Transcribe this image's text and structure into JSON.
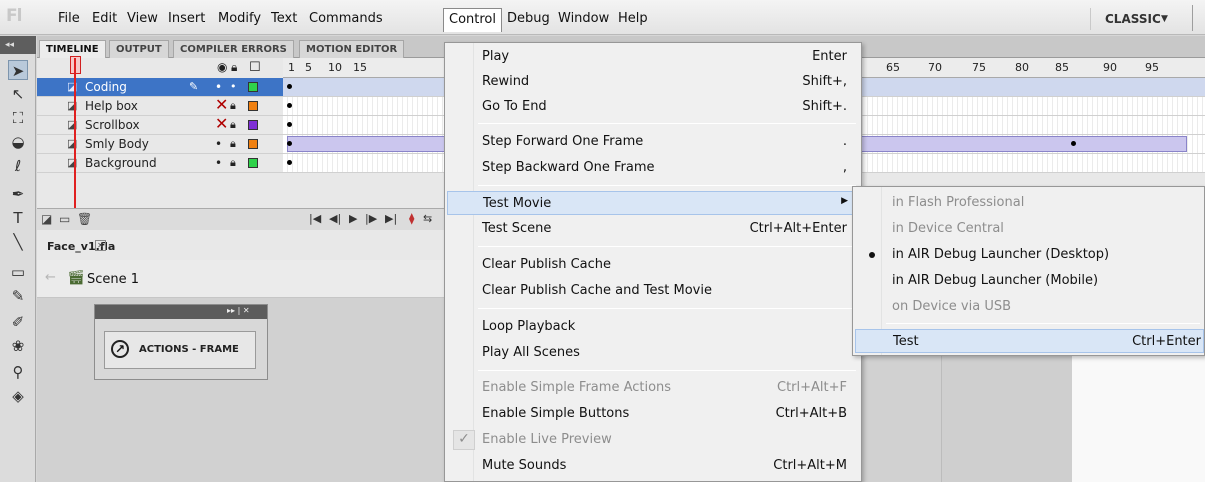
{
  "app": {
    "logo": "Fl"
  },
  "menubar": {
    "items": [
      "File",
      "Edit",
      "View",
      "Insert",
      "Modify",
      "Text",
      "Commands",
      "Control",
      "Debug",
      "Window",
      "Help"
    ],
    "active": "Control",
    "workspace": "CLASSIC"
  },
  "panel_tabs": [
    "TIMELINE",
    "OUTPUT",
    "COMPILER ERRORS",
    "MOTION EDITOR"
  ],
  "timeline": {
    "ruler": [
      "1",
      "5",
      "10",
      "15",
      "65",
      "70",
      "75",
      "80",
      "85",
      "90",
      "95"
    ],
    "current_frame": "1",
    "layers": [
      {
        "name": "Coding",
        "selected": true,
        "color": "#2fd24a"
      },
      {
        "name": "Help box",
        "hidden": true,
        "color": "#f08010"
      },
      {
        "name": "Scrollbox",
        "hidden": true,
        "color": "#7f2fd6"
      },
      {
        "name": "Smly Body",
        "color": "#f08010"
      },
      {
        "name": "Background",
        "color": "#2fd24a"
      }
    ]
  },
  "document": {
    "tab": "Face_v1.fla"
  },
  "scene": {
    "label": "Scene 1"
  },
  "actions_panel": {
    "label": "ACTIONS - FRAME"
  },
  "control_menu": {
    "items": [
      {
        "label": "Play",
        "shortcut": "Enter"
      },
      {
        "label": "Rewind",
        "shortcut": "Shift+,"
      },
      {
        "label": "Go To End",
        "shortcut": "Shift+."
      },
      {
        "label": "Step Forward One Frame",
        "shortcut": "."
      },
      {
        "label": "Step Backward One Frame",
        "shortcut": ","
      },
      {
        "label": "Test Movie",
        "shortcut": "",
        "submenu": true
      },
      {
        "label": "Test Scene",
        "shortcut": "Ctrl+Alt+Enter"
      },
      {
        "label": "Clear Publish Cache",
        "shortcut": ""
      },
      {
        "label": "Clear Publish Cache and Test Movie",
        "shortcut": ""
      },
      {
        "label": "Loop Playback",
        "shortcut": ""
      },
      {
        "label": "Play All Scenes",
        "shortcut": ""
      },
      {
        "label": "Enable Simple Frame Actions",
        "shortcut": "Ctrl+Alt+F",
        "disabled": true
      },
      {
        "label": "Enable Simple Buttons",
        "shortcut": "Ctrl+Alt+B"
      },
      {
        "label": "Enable Live Preview",
        "shortcut": "",
        "disabled": true,
        "checked": true
      },
      {
        "label": "Mute Sounds",
        "shortcut": "Ctrl+Alt+M"
      }
    ]
  },
  "test_submenu": {
    "items": [
      {
        "label": "in Flash Professional",
        "disabled": true
      },
      {
        "label": "in Device Central",
        "disabled": true
      },
      {
        "label": "in AIR Debug Launcher (Desktop)",
        "selected": true
      },
      {
        "label": "in AIR Debug Launcher (Mobile)"
      },
      {
        "label": "on Device via USB",
        "disabled": true
      },
      {
        "label": "Test",
        "shortcut": "Ctrl+Enter"
      }
    ]
  },
  "colors": {
    "accent": "#3d74c6",
    "menu_highlight": "#d9e6f6",
    "playhead": "#e02020",
    "tween": "#cbc6ee"
  }
}
